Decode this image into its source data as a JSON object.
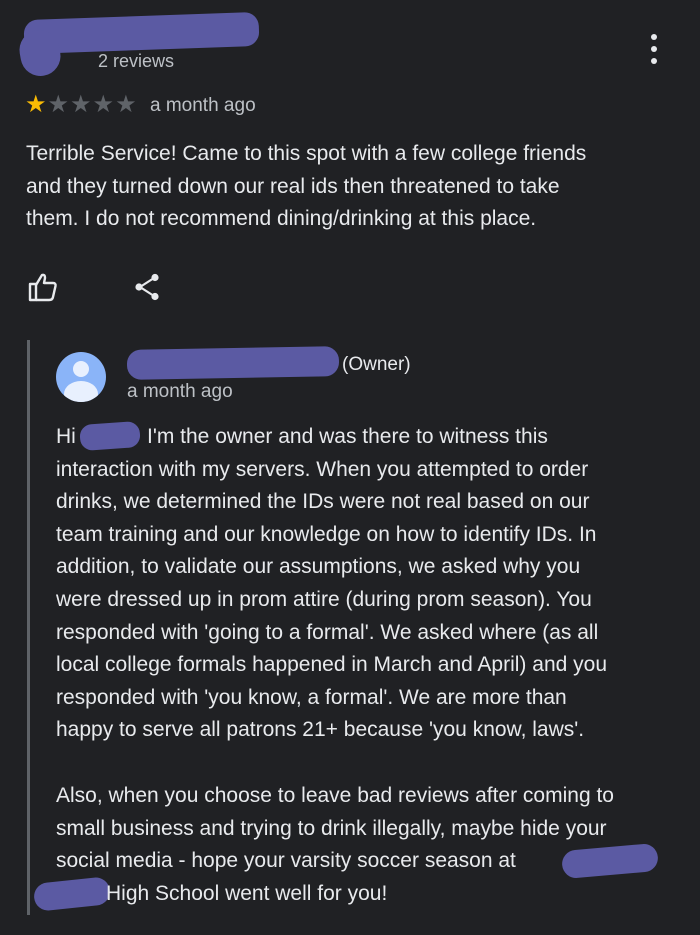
{
  "review": {
    "review_count": "2 reviews",
    "rating": 1,
    "stars_total": 5,
    "time_ago": "a month ago",
    "text": "Terrible Service! Came to this spot with a few college friends\nand they turned down our real ids then threatened to take\nthem. I do not recommend dining/drinking at this place."
  },
  "actions": {
    "like_icon": "thumbs-up-icon",
    "share_icon": "share-icon",
    "more_icon": "more-vert-icon"
  },
  "owner_reply": {
    "owner_tag": "(Owner)",
    "time_ago": "a month ago",
    "greeting": "Hi",
    "paragraph1_first": "I'm the owner and was there to witness this",
    "paragraph1_rest": "interaction with my servers. When you attempted to order\ndrinks, we determined the IDs were not real based on our\nteam training and our knowledge on how to identify IDs. In\naddition, to validate our assumptions, we asked why you\nwere dressed up in prom attire (during prom season). You\nresponded with 'going to a formal'. We asked where (as all\nlocal college formals happened in March and April) and you\nresponded with 'you know, a formal'. We are more than\nhappy to serve all patrons 21+ because 'you know, laws'.",
    "paragraph2": "Also, when you choose to leave bad reviews after coming to\nsmall business and trying to drink illegally, maybe hide your\nsocial media - hope your varsity soccer season at",
    "paragraph2_end": "High School went well for you!"
  },
  "colors": {
    "background": "#202124",
    "text": "#e8eaed",
    "secondary_text": "#bdc1c6",
    "star_filled": "#fbbc04",
    "star_empty": "#5f6368",
    "redaction": "#5b5aa3",
    "avatar": "#8ab4f8"
  }
}
